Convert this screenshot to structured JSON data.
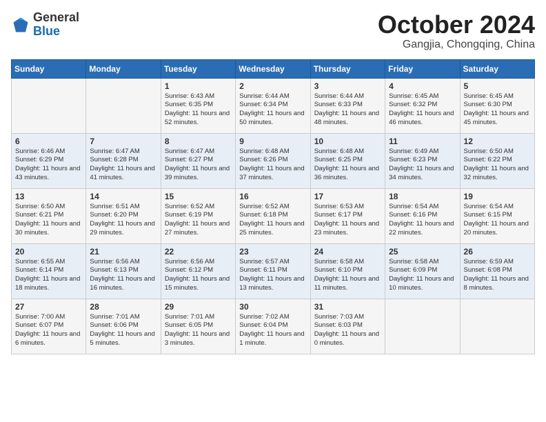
{
  "header": {
    "logo_general": "General",
    "logo_blue": "Blue",
    "month": "October 2024",
    "location": "Gangjia, Chongqing, China"
  },
  "weekdays": [
    "Sunday",
    "Monday",
    "Tuesday",
    "Wednesday",
    "Thursday",
    "Friday",
    "Saturday"
  ],
  "weeks": [
    [
      {
        "day": "",
        "info": ""
      },
      {
        "day": "",
        "info": ""
      },
      {
        "day": "1",
        "info": "Sunrise: 6:43 AM\nSunset: 6:35 PM\nDaylight: 11 hours and 52 minutes."
      },
      {
        "day": "2",
        "info": "Sunrise: 6:44 AM\nSunset: 6:34 PM\nDaylight: 11 hours and 50 minutes."
      },
      {
        "day": "3",
        "info": "Sunrise: 6:44 AM\nSunset: 6:33 PM\nDaylight: 11 hours and 48 minutes."
      },
      {
        "day": "4",
        "info": "Sunrise: 6:45 AM\nSunset: 6:32 PM\nDaylight: 11 hours and 46 minutes."
      },
      {
        "day": "5",
        "info": "Sunrise: 6:45 AM\nSunset: 6:30 PM\nDaylight: 11 hours and 45 minutes."
      }
    ],
    [
      {
        "day": "6",
        "info": "Sunrise: 6:46 AM\nSunset: 6:29 PM\nDaylight: 11 hours and 43 minutes."
      },
      {
        "day": "7",
        "info": "Sunrise: 6:47 AM\nSunset: 6:28 PM\nDaylight: 11 hours and 41 minutes."
      },
      {
        "day": "8",
        "info": "Sunrise: 6:47 AM\nSunset: 6:27 PM\nDaylight: 11 hours and 39 minutes."
      },
      {
        "day": "9",
        "info": "Sunrise: 6:48 AM\nSunset: 6:26 PM\nDaylight: 11 hours and 37 minutes."
      },
      {
        "day": "10",
        "info": "Sunrise: 6:48 AM\nSunset: 6:25 PM\nDaylight: 11 hours and 36 minutes."
      },
      {
        "day": "11",
        "info": "Sunrise: 6:49 AM\nSunset: 6:23 PM\nDaylight: 11 hours and 34 minutes."
      },
      {
        "day": "12",
        "info": "Sunrise: 6:50 AM\nSunset: 6:22 PM\nDaylight: 11 hours and 32 minutes."
      }
    ],
    [
      {
        "day": "13",
        "info": "Sunrise: 6:50 AM\nSunset: 6:21 PM\nDaylight: 11 hours and 30 minutes."
      },
      {
        "day": "14",
        "info": "Sunrise: 6:51 AM\nSunset: 6:20 PM\nDaylight: 11 hours and 29 minutes."
      },
      {
        "day": "15",
        "info": "Sunrise: 6:52 AM\nSunset: 6:19 PM\nDaylight: 11 hours and 27 minutes."
      },
      {
        "day": "16",
        "info": "Sunrise: 6:52 AM\nSunset: 6:18 PM\nDaylight: 11 hours and 25 minutes."
      },
      {
        "day": "17",
        "info": "Sunrise: 6:53 AM\nSunset: 6:17 PM\nDaylight: 11 hours and 23 minutes."
      },
      {
        "day": "18",
        "info": "Sunrise: 6:54 AM\nSunset: 6:16 PM\nDaylight: 11 hours and 22 minutes."
      },
      {
        "day": "19",
        "info": "Sunrise: 6:54 AM\nSunset: 6:15 PM\nDaylight: 11 hours and 20 minutes."
      }
    ],
    [
      {
        "day": "20",
        "info": "Sunrise: 6:55 AM\nSunset: 6:14 PM\nDaylight: 11 hours and 18 minutes."
      },
      {
        "day": "21",
        "info": "Sunrise: 6:56 AM\nSunset: 6:13 PM\nDaylight: 11 hours and 16 minutes."
      },
      {
        "day": "22",
        "info": "Sunrise: 6:56 AM\nSunset: 6:12 PM\nDaylight: 11 hours and 15 minutes."
      },
      {
        "day": "23",
        "info": "Sunrise: 6:57 AM\nSunset: 6:11 PM\nDaylight: 11 hours and 13 minutes."
      },
      {
        "day": "24",
        "info": "Sunrise: 6:58 AM\nSunset: 6:10 PM\nDaylight: 11 hours and 11 minutes."
      },
      {
        "day": "25",
        "info": "Sunrise: 6:58 AM\nSunset: 6:09 PM\nDaylight: 11 hours and 10 minutes."
      },
      {
        "day": "26",
        "info": "Sunrise: 6:59 AM\nSunset: 6:08 PM\nDaylight: 11 hours and 8 minutes."
      }
    ],
    [
      {
        "day": "27",
        "info": "Sunrise: 7:00 AM\nSunset: 6:07 PM\nDaylight: 11 hours and 6 minutes."
      },
      {
        "day": "28",
        "info": "Sunrise: 7:01 AM\nSunset: 6:06 PM\nDaylight: 11 hours and 5 minutes."
      },
      {
        "day": "29",
        "info": "Sunrise: 7:01 AM\nSunset: 6:05 PM\nDaylight: 11 hours and 3 minutes."
      },
      {
        "day": "30",
        "info": "Sunrise: 7:02 AM\nSunset: 6:04 PM\nDaylight: 11 hours and 1 minute."
      },
      {
        "day": "31",
        "info": "Sunrise: 7:03 AM\nSunset: 6:03 PM\nDaylight: 11 hours and 0 minutes."
      },
      {
        "day": "",
        "info": ""
      },
      {
        "day": "",
        "info": ""
      }
    ]
  ]
}
